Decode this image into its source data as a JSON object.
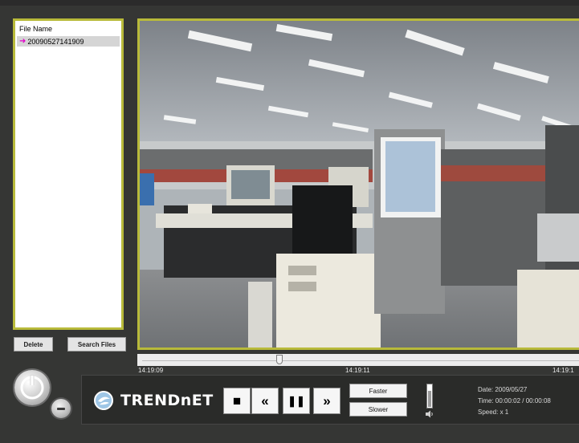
{
  "file_list": {
    "header": "File Name",
    "items": [
      {
        "name": "20090527141909",
        "selected": true
      }
    ]
  },
  "buttons": {
    "delete": "Delete",
    "search_files": "Search Files"
  },
  "timeline": {
    "start_time": "14:19:09",
    "mid_time": "14:19:11",
    "end_time": "14:19:1",
    "position": 0.32
  },
  "brand": {
    "logo_text": "TRENDnET"
  },
  "playback": {
    "stop_icon": "stop-icon",
    "rewind_icon": "rewind-icon",
    "pause_icon": "pause-icon",
    "forward_icon": "fast-forward-icon",
    "faster_label": "Faster",
    "slower_label": "Slower"
  },
  "volume": {
    "level": 0.75,
    "icon": "speaker-icon"
  },
  "info": {
    "date": "Date: 2009/05/27",
    "time": "Time: 00:00:02 / 00:00:08",
    "speed": "Speed: x 1"
  },
  "colors": {
    "frame_accent": "#b8ba3a",
    "background": "#353634",
    "arrow": "#e000c8"
  }
}
